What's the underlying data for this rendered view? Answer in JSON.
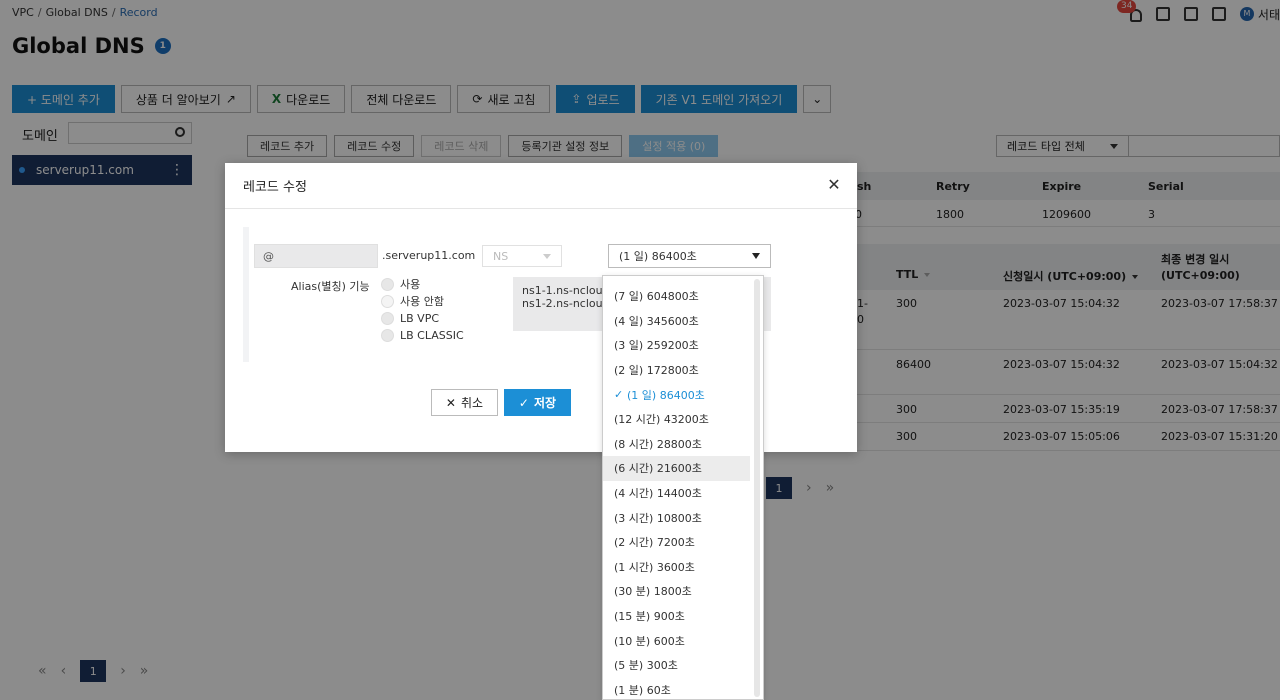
{
  "breadcrumb": {
    "items": [
      "VPC",
      "Global DNS"
    ],
    "current": "Record"
  },
  "header": {
    "notif_count": "34",
    "user_initial": "M",
    "user_name": "서태"
  },
  "title": {
    "text": "Global DNS",
    "badge": "1"
  },
  "toolbar": {
    "add_domain": "+ 도메인 추가",
    "learn_more": "상품 더 알아보기",
    "download": "다운로드",
    "download_all": "전체 다운로드",
    "refresh": "새로 고침",
    "upload": "업로드",
    "import_v1": "기존 V1 도메인 가져오기"
  },
  "domain_panel": {
    "label": "도메인",
    "selected_domain": "serverup11.com"
  },
  "record_tools": {
    "add": "레코드 추가",
    "edit": "레코드 수정",
    "delete": "레코드 삭제",
    "registrar": "등록기관 설정 정보",
    "apply": "설정 적용 (0)",
    "type_filter": "레코드 타입 전체"
  },
  "soa": {
    "headers": [
      "sh",
      "Retry",
      "Expire",
      "Serial"
    ],
    "row": [
      "0",
      "1800",
      "1209600",
      "3"
    ]
  },
  "records": {
    "headers": {
      "ttl": "TTL",
      "requested": "신청일시 (UTC+09:00)",
      "modified": "최종 변경 일시 (UTC+09:00)"
    },
    "rows": [
      {
        "frag": "1-\n0",
        "ttl": "300",
        "requested": "2023-03-07 15:04:32",
        "modified": "2023-03-07 17:58:37"
      },
      {
        "frag": "",
        "ttl": "86400",
        "requested": "2023-03-07 15:04:32",
        "modified": "2023-03-07 15:04:32"
      },
      {
        "frag": "",
        "ttl": "300",
        "requested": "2023-03-07 15:35:19",
        "modified": "2023-03-07 17:58:37"
      },
      {
        "frag": "",
        "ttl": "300",
        "requested": "2023-03-07 15:05:06",
        "modified": "2023-03-07 15:31:20"
      }
    ]
  },
  "pagination": {
    "current": "1"
  },
  "modal": {
    "title": "레코드 수정",
    "record_name": "@",
    "domain_suffix": ".serverup11.com",
    "record_type": "NS",
    "ttl_selected": "(1 일) 86400초",
    "alias_label": "Alias(별칭) 기능",
    "alias_options": [
      "사용",
      "사용 안함",
      "LB VPC",
      "LB CLASSIC"
    ],
    "ns_values": [
      "ns1-1.ns-ncloud.c",
      "ns1-2.ns-ncloud.c"
    ],
    "cancel": "취소",
    "save": "저장"
  },
  "ttl_options": [
    "(7 일) 604800초",
    "(4 일) 345600초",
    "(3 일) 259200초",
    "(2 일) 172800초",
    "(1 일) 86400초",
    "(12 시간) 43200초",
    "(8 시간) 28800초",
    "(6 시간) 21600초",
    "(4 시간) 14400초",
    "(3 시간) 10800초",
    "(2 시간) 7200초",
    "(1 시간) 3600초",
    "(30 분) 1800초",
    "(15 분) 900초",
    "(10 분) 600초",
    "(5 분) 300초",
    "(1 분) 60초"
  ],
  "colors": {
    "primary": "#1c8fd6",
    "navy": "#1e3560",
    "badge": "#e5483f"
  }
}
